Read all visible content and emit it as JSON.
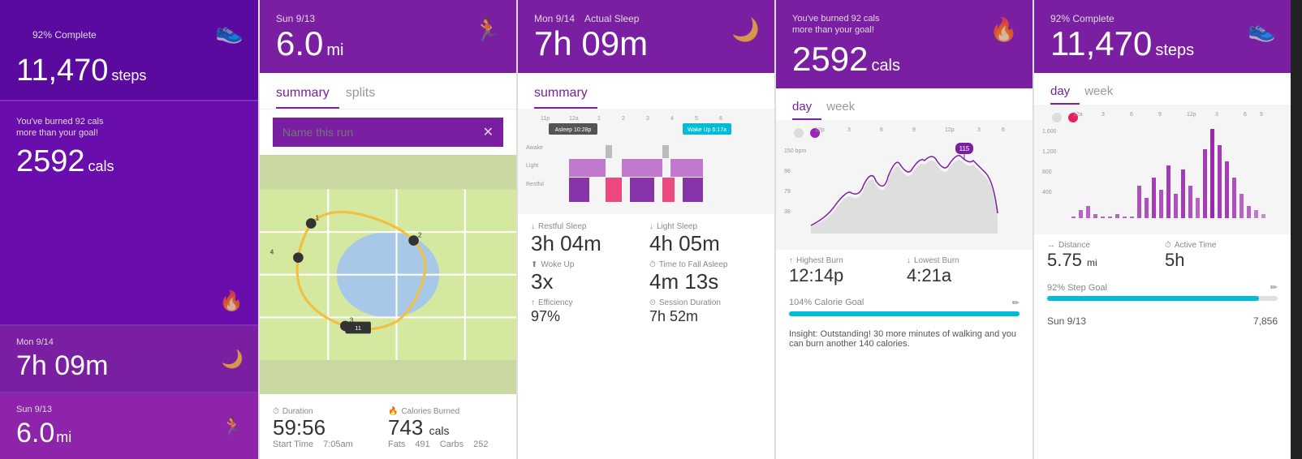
{
  "panel1": {
    "complete_label": "92% Complete",
    "steps_value": "11,470",
    "steps_unit": "steps",
    "burned_note": "You've burned 92 cals\nmore than your goal!",
    "cals_value": "2592",
    "cals_unit": "cals",
    "sleep_date": "Mon 9/14",
    "sleep_value": "7h 09m",
    "run_date": "Sun 9/13",
    "run_value": "6.0",
    "run_unit": "mi"
  },
  "panel2": {
    "date": "Sun 9/13",
    "miles": "6.0",
    "miles_unit": "mi",
    "tab_summary": "summary",
    "tab_splits": "splits",
    "search_placeholder": "Name this run",
    "duration_label": "Duration",
    "duration_value": "59:56",
    "cals_label": "Calories Burned",
    "cals_value": "743",
    "cals_unit": "cals",
    "start_time_label": "Start Time",
    "start_time_value": "7:05am",
    "fats_label": "Fats",
    "fats_value": "491",
    "carbs_label": "Carbs",
    "carbs_value": "252"
  },
  "panel3": {
    "date": "Mon 9/14",
    "sleep_type": "Actual Sleep",
    "sleep_value": "7h 09m",
    "tab_summary": "summary",
    "restful_label": "Restful Sleep",
    "restful_value": "3h 04m",
    "light_label": "Light Sleep",
    "light_value": "4h 05m",
    "woke_label": "Woke Up",
    "woke_value": "3x",
    "fall_label": "Time to Fall Asleep",
    "fall_value": "4m 13s",
    "efficiency_label": "Efficiency",
    "session_label": "Session Duration",
    "asleep_label": "Asleep 10:28p",
    "wakeup_label": "Wake Up 6:17a"
  },
  "panel4": {
    "burned_note": "You've burned 92 cals\nmore than your goal!",
    "cals_value": "2592",
    "cals_unit": "cals",
    "tab_day": "day",
    "tab_week": "week",
    "highest_label": "Highest Burn",
    "highest_value": "12:14p",
    "lowest_label": "Lowest Burn",
    "lowest_value": "4:21a",
    "goal_label": "104% Calorie Goal",
    "goal_pct": 104,
    "insight_text": "Insight: Outstanding! 30 more minutes of walking and you can burn another 140 calories."
  },
  "panel5": {
    "complete_label": "92% Complete",
    "steps_value": "11,470",
    "steps_unit": "steps",
    "tab_day": "day",
    "tab_week": "week",
    "distance_label": "Distance",
    "distance_value": "5.75",
    "distance_unit": "mi",
    "active_label": "Active Time",
    "active_value": "5h",
    "goal_label": "92% Step Goal",
    "goal_pct": 92,
    "bottom_date": "Sun 9/13",
    "bottom_value": "7,856"
  }
}
